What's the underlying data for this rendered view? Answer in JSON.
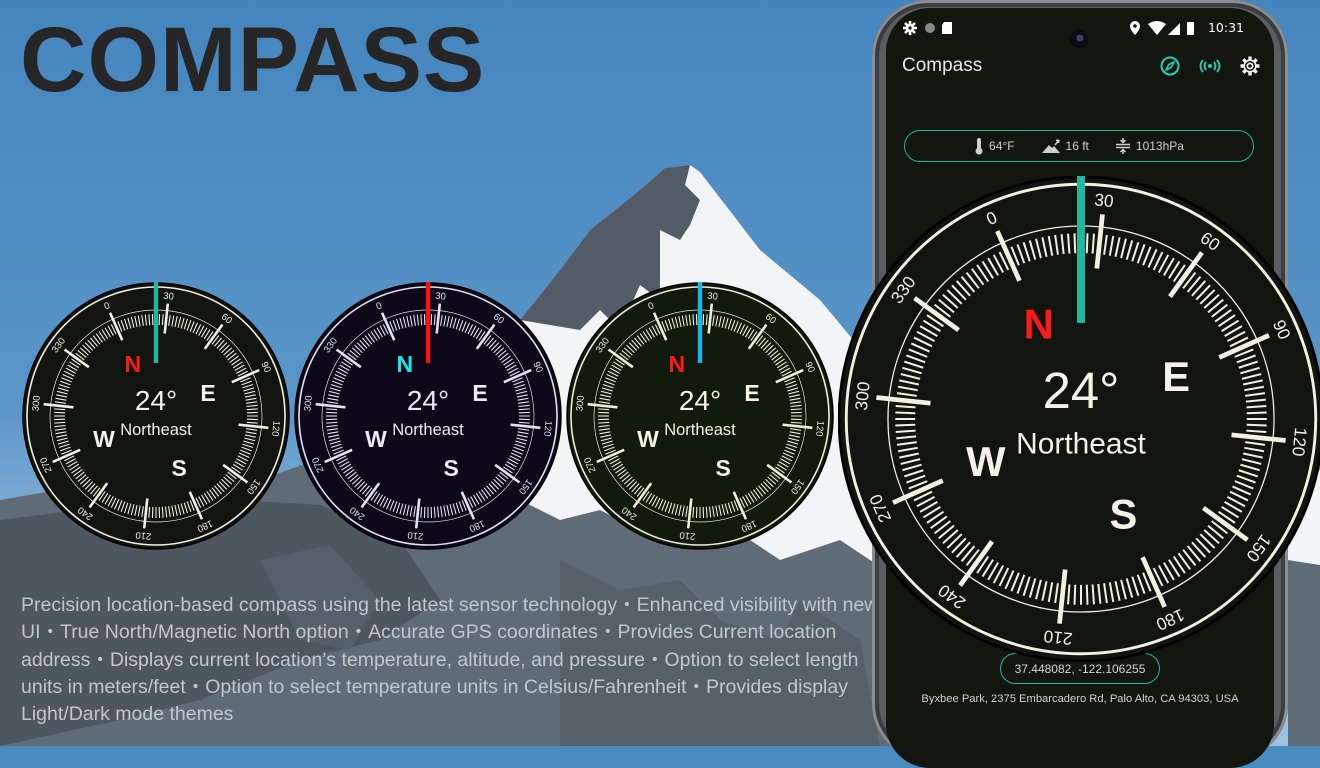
{
  "promo": {
    "title": "COMPASS",
    "description": "Precision location-based compass using the latest sensor technology・Enhanced visibility with new UI・True North/Magnetic North option・Accurate GPS coordinates・Provides Current location address・Displays current location’s temperature, altitude, and pressure・Option to select length units in meters/feet・Option to select temperature units in Celsius/Fahrenheit・Provides display Light/Dark mode themes"
  },
  "compass_reading": {
    "heading_deg": 24,
    "heading_label": "24°",
    "direction": "Northeast",
    "cardinals": [
      "N",
      "E",
      "S",
      "W"
    ],
    "dial_labels": [
      "0",
      "30",
      "60",
      "90",
      "120",
      "150",
      "180",
      "210",
      "240",
      "270",
      "300",
      "330"
    ]
  },
  "theme_previews": [
    {
      "name": "dark-green",
      "face": "#121410",
      "ring": "#f2f0e0",
      "needle": "#1fb8a3",
      "north": "#ff1a1a",
      "letters": "#f4f2e6"
    },
    {
      "name": "dark-purple",
      "face": "#0d0818",
      "ring": "#e4e0f4",
      "needle": "#ff1010",
      "north": "#19e6e6",
      "letters": "#ece8fa"
    },
    {
      "name": "olive",
      "face": "#111a0c",
      "ring": "#eeeed8",
      "needle": "#1ab4e6",
      "north": "#ff1a1a",
      "letters": "#f4f4e0"
    }
  ],
  "phone": {
    "status_bar": {
      "left_icons": [
        "settings-icon",
        "circle-icon",
        "sd-card-icon"
      ],
      "right_icons": [
        "location-pin-icon",
        "wifi-icon",
        "signal-icon",
        "battery-icon"
      ],
      "time": "10:31"
    },
    "app_bar": {
      "title": "Compass",
      "actions": [
        "compass-icon",
        "broadcast-icon",
        "settings-icon"
      ],
      "accent": "#1fd1b9"
    },
    "environment": {
      "temperature": "64°F",
      "altitude": "16 ft",
      "pressure": "1013hPa"
    },
    "coordinates": "37.448082, -122.106255",
    "address": "Byxbee Park, 2375 Embarcadero Rd, Palo Alto, CA 94303, USA",
    "compass_theme": {
      "face": "#121410",
      "ring": "#f2f0e0",
      "needle": "#1fb8a3",
      "north": "#ff1a1a",
      "letters": "#f4f2e6"
    }
  }
}
